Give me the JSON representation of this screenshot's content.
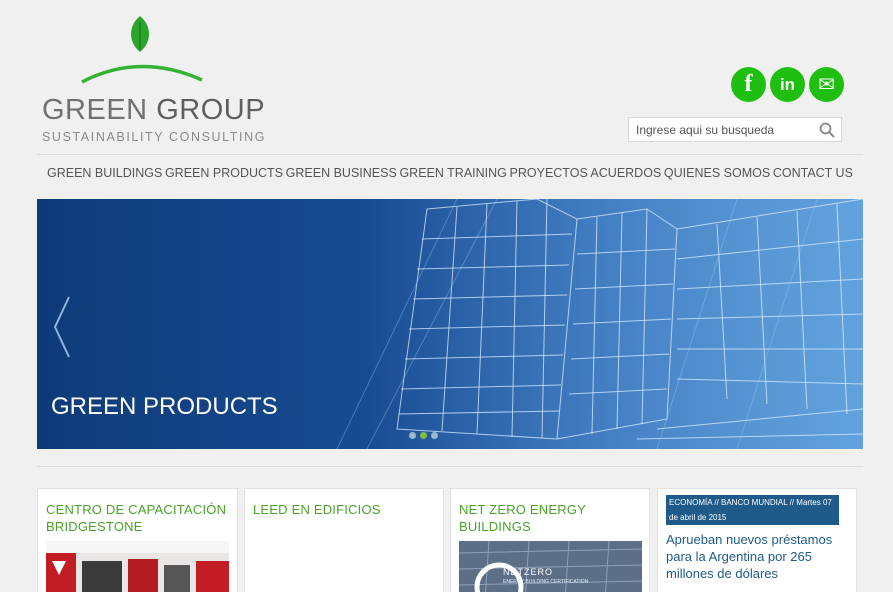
{
  "brand": {
    "name_part1": "GREEN",
    "name_part2": "GROUP",
    "tagline": "SUSTAINABILITY CONSULTING",
    "accent": "#1fbf12",
    "text_green": "#4aa32a"
  },
  "social": {
    "facebook": "f",
    "linkedin": "in",
    "email": "✉"
  },
  "search": {
    "placeholder": "Ingrese aqui su busqueda"
  },
  "nav": {
    "items": [
      "GREEN BUILDINGS",
      "GREEN PRODUCTS",
      "GREEN BUSINESS",
      "GREEN TRAINING",
      "PROYECTOS",
      "ACUERDOS",
      "QUIENES SOMOS",
      "CONTACT US"
    ]
  },
  "banner": {
    "title": "GREEN PRODUCTS",
    "slides": 3,
    "active_slide": 2
  },
  "cards": [
    {
      "title": "CENTRO DE CAPACITACIÓN BRIDGESTONE"
    },
    {
      "title": "LEED EN EDIFICIOS"
    },
    {
      "title": "NET ZERO ENERGY BUILDINGS",
      "thumb_text": "NETZERO",
      "thumb_subtext": "ENERGY BUILDING CERTIFICATION"
    }
  ],
  "news": {
    "tag": "ECONOMÍA // BANCO MUNDIAL // Martes 07 de abril de 2015",
    "title": "Aprueban nuevos préstamos para la Argentina por 265 millones de dólares"
  }
}
